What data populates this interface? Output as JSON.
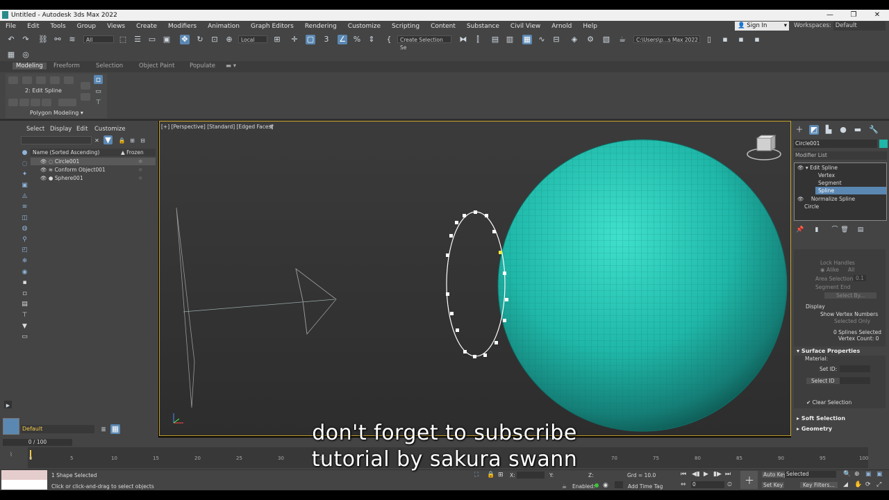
{
  "window": {
    "title": "Untitled - Autodesk 3ds Max 2022",
    "minimize": "—",
    "maximize": "❐",
    "close": "✕"
  },
  "menu": [
    "File",
    "Edit",
    "Tools",
    "Group",
    "Views",
    "Create",
    "Modifiers",
    "Animation",
    "Graph Editors",
    "Rendering",
    "Customize",
    "Scripting",
    "Content",
    "Substance",
    "Civil View",
    "Arnold",
    "Help"
  ],
  "account": {
    "signin": "Sign In",
    "workspace_label": "Workspaces:",
    "workspace_value": "Default"
  },
  "toolbar": {
    "filter": "All",
    "ref_coord": "Local",
    "selection_set": "Create Selection Se",
    "path": "C:\\Users\\p...s Max 2022"
  },
  "ribbon": {
    "tabs": [
      "Modeling",
      "Freeform",
      "Selection",
      "Object Paint",
      "Populate"
    ],
    "mode": "2: Edit Spline",
    "group": "Polygon Modeling ▾"
  },
  "scene_explorer": {
    "menu": [
      "Select",
      "Display",
      "Edit",
      "Customize"
    ],
    "col_name": "Name (Sorted Ascending)",
    "col_frozen": "▲ Frozen",
    "rows": [
      "Circle001",
      "Conform Object001",
      "Sphere001"
    ],
    "layer": "Default"
  },
  "viewport": {
    "label": "[+] [Perspective] [Standard] [Edged Faces]"
  },
  "command_panel": {
    "object_name": "Circle001",
    "object_color": "#1fb7a8",
    "modifier_list": "Modifier List",
    "stack": [
      "Edit Spline",
      "Vertex",
      "Segment",
      "Spline",
      "Normalize Spline",
      "Circle"
    ],
    "lock_handles": "Lock Handles",
    "alike": "Alike",
    "all": "All",
    "area_selection": "Area Selection:",
    "area_value": "0.1",
    "segment_end": "Segment End",
    "select_by": "Select By...",
    "display_header": "Display",
    "show_vertex_numbers": "Show Vertex Numbers",
    "selected_only": "Selected Only",
    "splines_selected": "0 Splines Selected",
    "vertex_count": "Vertex Count: 0",
    "surface_properties": "Surface Properties",
    "material": "Material:",
    "set_id": "Set ID:",
    "select_id": "Select ID",
    "clear_selection": "Clear Selection",
    "soft_selection": "Soft Selection",
    "geometry": "Geometry"
  },
  "timeline": {
    "frame": "0 / 100",
    "ticks": [
      "0",
      "5",
      "10",
      "15",
      "20",
      "25",
      "30",
      "35",
      "70",
      "75",
      "80",
      "85",
      "90",
      "95",
      "100"
    ]
  },
  "status": {
    "selection": "1 Shape Selected",
    "prompt": "Click or click-and-drag to select objects",
    "x_label": "X:",
    "y_label": "Y:",
    "z_label": "Z:",
    "grid": "Grd = 10.0",
    "enabled": "Enabled:",
    "add_time_tag": "Add Time Tag",
    "auto_key": "Auto Key",
    "selected": "Selected",
    "set_key": "Set Key",
    "key_filters": "Key Filters...",
    "frame_field": "0"
  },
  "subtitles": [
    "don't forget to subscribe",
    "tutorial by sakura swann"
  ]
}
